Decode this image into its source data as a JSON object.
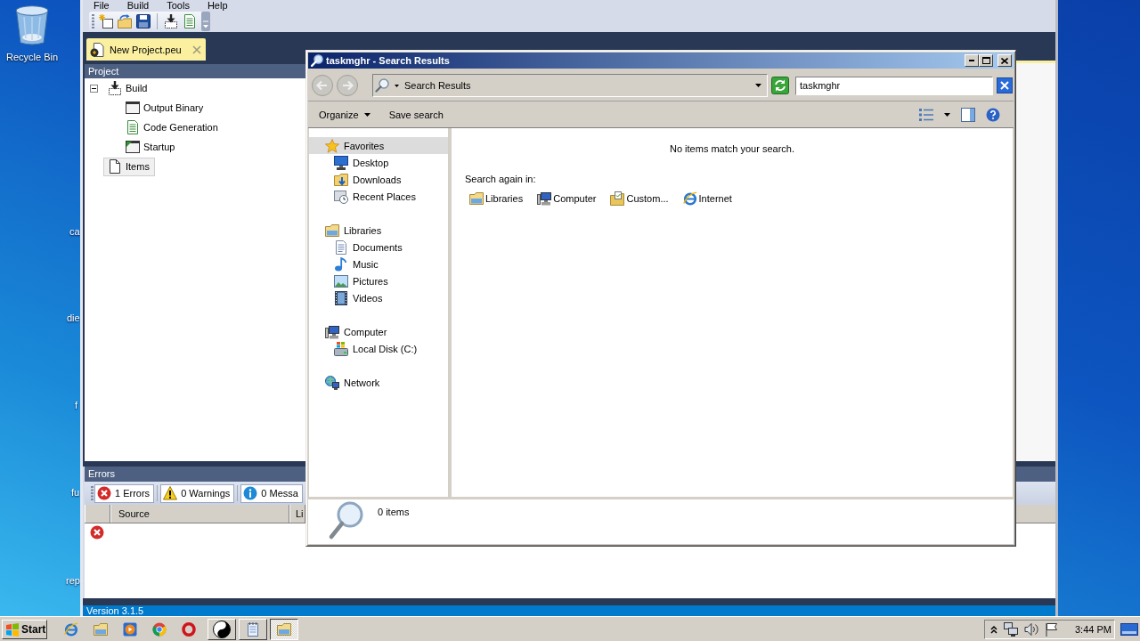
{
  "desktop": {
    "icons": [
      {
        "label": "Recycle Bin",
        "kind": "recycle-bin"
      }
    ],
    "cut_labels": [
      "ca",
      "die",
      "f",
      "fu",
      "rep"
    ]
  },
  "editor": {
    "menu": [
      "File",
      "Build",
      "Tools",
      "Help"
    ],
    "toolbar": [
      {
        "kind": "new"
      },
      {
        "kind": "open"
      },
      {
        "kind": "save"
      },
      {
        "kind": "separator"
      },
      {
        "kind": "build"
      },
      {
        "kind": "document"
      }
    ],
    "document_tab": {
      "label": "New Project.peu",
      "selected": true
    },
    "project_panel": {
      "title": "Project",
      "tree": [
        {
          "label": "Build",
          "kind": "build",
          "expanded": true,
          "selected": false,
          "children": [
            {
              "label": "Output Binary",
              "kind": "window",
              "selected": false
            },
            {
              "label": "Code Generation",
              "kind": "code",
              "selected": false
            },
            {
              "label": "Startup",
              "kind": "startup",
              "selected": false
            }
          ]
        },
        {
          "label": "Items",
          "kind": "page",
          "selected": true
        }
      ]
    },
    "errors_panel": {
      "title": "Errors",
      "filters": [
        {
          "kind": "error",
          "label": "1 Errors"
        },
        {
          "kind": "warning",
          "label": "0 Warnings"
        },
        {
          "kind": "info",
          "label": "0 Messa"
        }
      ],
      "columns": [
        "Source",
        "Li"
      ],
      "rows": [
        {
          "kind": "error"
        }
      ]
    },
    "status_bar": "Version 3.1.5"
  },
  "search_window": {
    "title": "taskmghr - Search Results",
    "navigation": [
      {
        "kind": "back",
        "disabled": true
      },
      {
        "kind": "forward",
        "disabled": true
      }
    ],
    "address": "Search Results",
    "search_field": {
      "value": "taskmghr"
    },
    "commands": [
      {
        "label": "Organize",
        "kind": "menu"
      },
      {
        "label": "Save search",
        "kind": "plain"
      }
    ],
    "nav_pane": [
      {
        "label": "Favorites",
        "kind": "favorites",
        "selected": true,
        "children": [
          {
            "label": "Desktop",
            "kind": "desktop",
            "selected": false
          },
          {
            "label": "Downloads",
            "kind": "downloads",
            "selected": false
          },
          {
            "label": "Recent Places",
            "kind": "recent",
            "selected": false
          }
        ]
      },
      {
        "label": "Libraries",
        "kind": "libraries",
        "selected": false,
        "children": [
          {
            "label": "Documents",
            "kind": "documents",
            "selected": false
          },
          {
            "label": "Music",
            "kind": "music",
            "selected": false
          },
          {
            "label": "Pictures",
            "kind": "pictures",
            "selected": false
          },
          {
            "label": "Videos",
            "kind": "videos",
            "selected": false
          }
        ]
      },
      {
        "label": "Computer",
        "kind": "computer",
        "selected": false,
        "children": [
          {
            "label": "Local Disk (C:)",
            "kind": "disk",
            "selected": false
          }
        ]
      },
      {
        "label": "Network",
        "kind": "network",
        "selected": false
      }
    ],
    "message": "No items match your search.",
    "search_again": {
      "label": "Search again in:",
      "locations": [
        {
          "label": "Libraries",
          "kind": "libraries"
        },
        {
          "label": "Computer",
          "kind": "computer"
        },
        {
          "label": "Custom...",
          "kind": "custom"
        },
        {
          "label": "Internet",
          "kind": "internet"
        }
      ]
    },
    "details": "0 items"
  },
  "taskbar": {
    "start": "Start",
    "pinned": [
      {
        "kind": "browser"
      },
      {
        "kind": "folder"
      },
      {
        "kind": "player"
      },
      {
        "kind": "ring"
      },
      {
        "kind": "letter-o"
      }
    ],
    "tasks": [
      {
        "kind": "yin-yang",
        "selected": false
      },
      {
        "kind": "notepad",
        "selected": false
      },
      {
        "kind": "folder",
        "selected": true
      }
    ],
    "tray": [
      {
        "kind": "chevron"
      },
      {
        "kind": "connection"
      },
      {
        "kind": "speaker"
      },
      {
        "kind": "flag"
      }
    ],
    "clock": "3:44 PM"
  }
}
